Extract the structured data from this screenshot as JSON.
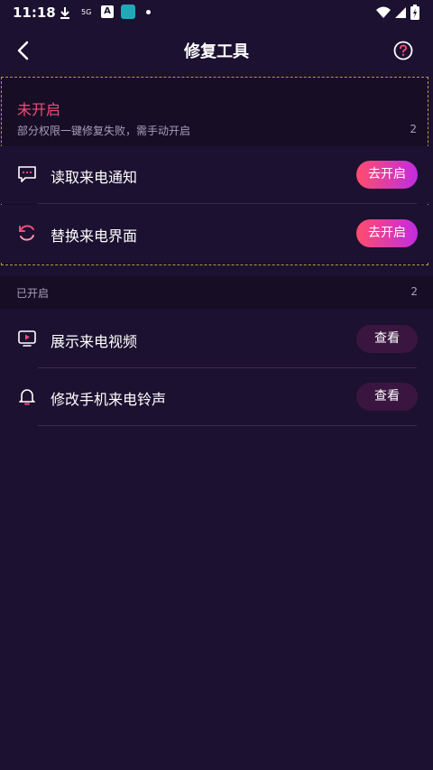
{
  "status_bar": {
    "time": "11:18",
    "network_label": "5G",
    "app_a_letter": "A"
  },
  "header": {
    "title": "修复工具"
  },
  "disabled_section": {
    "title": "未开启",
    "subtitle": "部分权限一键修复失败，需手动开启",
    "count": "2",
    "items": [
      {
        "label": "读取来电通知",
        "icon": "message-icon",
        "button": "去开启"
      },
      {
        "label": "替换来电界面",
        "icon": "refresh-icon",
        "button": "去开启"
      }
    ]
  },
  "enabled_section": {
    "title": "已开启",
    "count": "2",
    "items": [
      {
        "label": "展示来电视频",
        "icon": "video-icon",
        "button": "查看"
      },
      {
        "label": "修改手机来电铃声",
        "icon": "bell-icon",
        "button": "查看"
      }
    ]
  },
  "colors": {
    "background": "#1c1130",
    "accent_red": "#ee4d7a",
    "gradient_start": "#ff4d6d",
    "gradient_end": "#c02ce0",
    "view_button": "#3a1540"
  }
}
